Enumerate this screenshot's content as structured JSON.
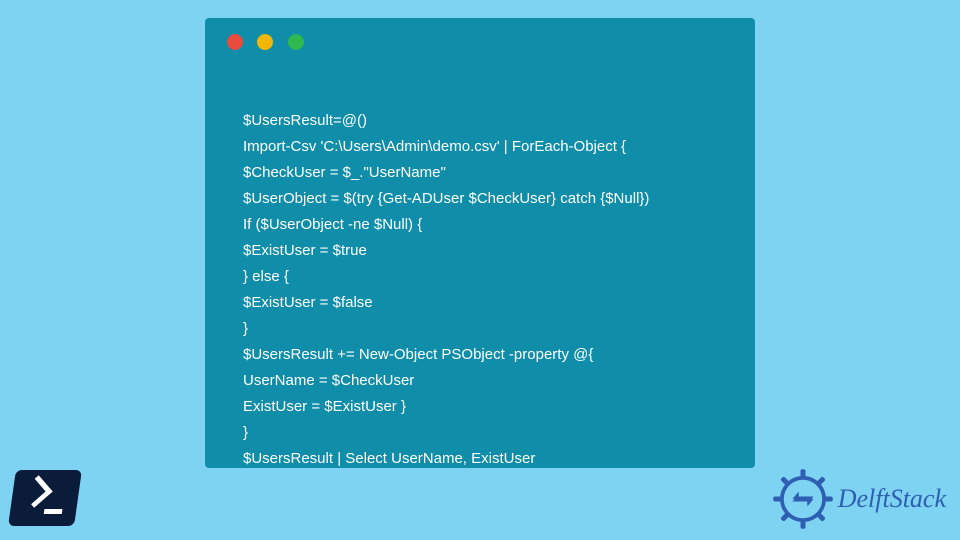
{
  "code": {
    "lines": [
      "$UsersResult=@()",
      "Import-Csv 'C:\\Users\\Admin\\demo.csv' | ForEach-Object {",
      "$CheckUser = $_.\"UserName\"",
      "$UserObject = $(try {Get-ADUser $CheckUser} catch {$Null})",
      "If ($UserObject -ne $Null) {",
      "$ExistUser = $true",
      "} else {",
      "$ExistUser = $false",
      "}",
      "$UsersResult += New-Object PSObject -property @{",
      "UserName = $CheckUser",
      "ExistUser = $ExistUser }",
      "}",
      "$UsersResult | Select UserName, ExistUser"
    ]
  },
  "branding": {
    "name": "DelftStack"
  },
  "window": {
    "dot_colors": [
      "#e94b3c",
      "#f2b705",
      "#2fb84f"
    ]
  }
}
